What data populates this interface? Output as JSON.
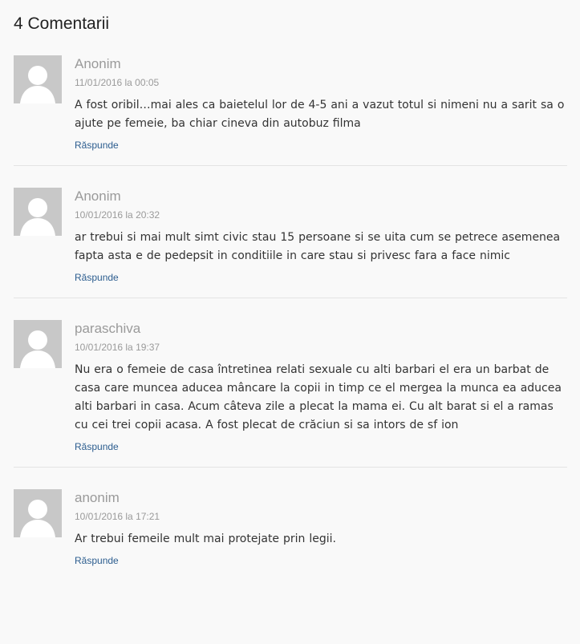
{
  "heading": "4 Comentarii",
  "comments": [
    {
      "author": "Anonim",
      "date": "11/01/2016 la 00:05",
      "text": "A fost oribil…mai ales ca baietelul lor de 4-5 ani a vazut totul si nimeni nu a sarit sa o ajute pe femeie, ba chiar cineva din autobuz filma",
      "reply": "Răspunde"
    },
    {
      "author": "Anonim",
      "date": "10/01/2016 la 20:32",
      "text": "ar trebui si mai mult simt civic stau 15 persoane si se uita cum se petrece asemenea fapta asta e de pedepsit in conditiile in care stau si privesc fara a face nimic",
      "reply": "Răspunde"
    },
    {
      "author": "paraschiva",
      "date": "10/01/2016 la 19:37",
      "text": "Nu era o femeie de casa întretinea relati sexuale cu alti barbari el era un barbat de casa care muncea aducea mâncare la copii in timp ce el mergea la munca ea aducea alti barbari in casa. Acum câteva zile a plecat la mama ei. Cu alt barat si el a ramas cu cei trei copii acasa. A fost plecat de crăciun si sa intors de sf ion",
      "reply": "Răspunde"
    },
    {
      "author": "anonim",
      "date": "10/01/2016 la 17:21",
      "text": "Ar trebui femeile mult mai protejate prin legii.",
      "reply": "Răspunde"
    }
  ],
  "colors": {
    "background": "#f9f9f9",
    "author": "#9a9a9a",
    "reply_link": "#2c5d8f",
    "avatar_bg": "#c8c8c8"
  },
  "icons": {
    "avatar": "default-user-avatar-icon"
  }
}
